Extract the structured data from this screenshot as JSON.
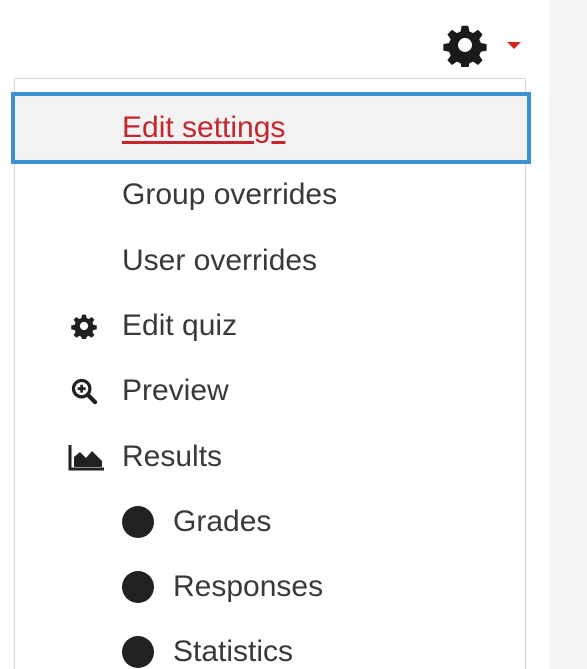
{
  "menu": {
    "items": [
      {
        "label": "Edit settings",
        "icon": "",
        "active": true
      },
      {
        "label": "Group overrides",
        "icon": ""
      },
      {
        "label": "User overrides",
        "icon": ""
      },
      {
        "label": "Edit quiz",
        "icon": "gear-icon"
      },
      {
        "label": "Preview",
        "icon": "zoom-in-icon"
      },
      {
        "label": "Results",
        "icon": "area-chart-icon"
      },
      {
        "label": "Grades",
        "icon": "bullet-icon"
      },
      {
        "label": "Responses",
        "icon": "bullet-icon"
      },
      {
        "label": "Statistics",
        "icon": "bullet-icon"
      }
    ]
  },
  "colors": {
    "active_text": "#c4262e",
    "focus_border": "#3d8fd6",
    "caret": "#d0281e",
    "text": "#373a3c"
  }
}
